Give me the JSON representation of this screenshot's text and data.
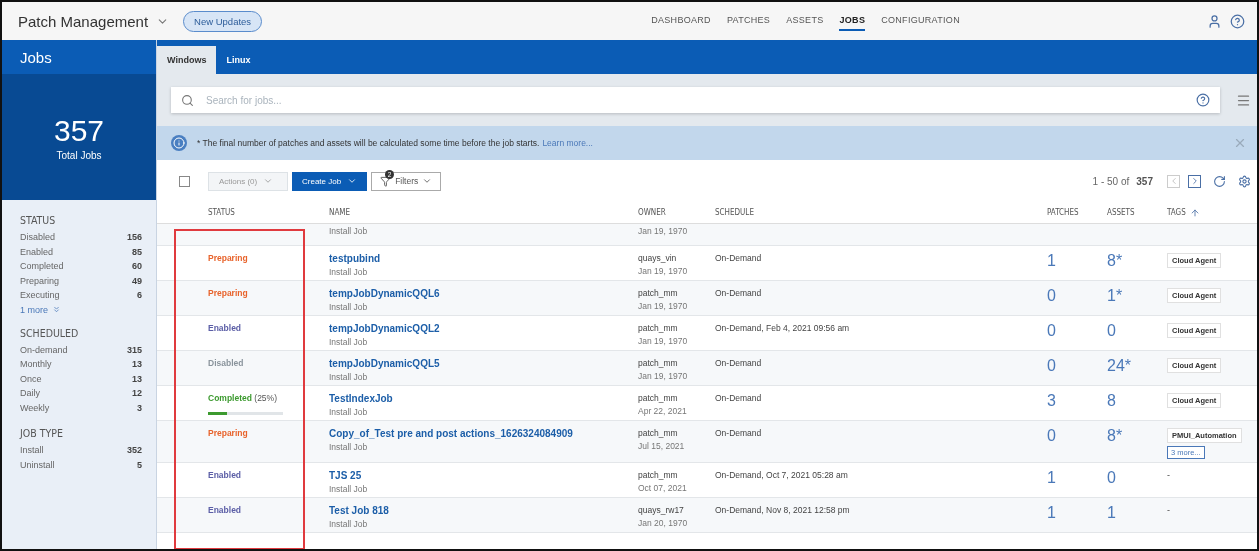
{
  "app": {
    "title": "Patch Management",
    "badge": "New Updates"
  },
  "nav": [
    {
      "label": "DASHBOARD",
      "selected": false
    },
    {
      "label": "PATCHES",
      "selected": false
    },
    {
      "label": "ASSETS",
      "selected": false
    },
    {
      "label": "JOBS",
      "selected": true
    },
    {
      "label": "CONFIGURATION",
      "selected": false
    }
  ],
  "sidebar": {
    "title": "Jobs",
    "total": "357",
    "total_label": "Total Jobs",
    "groups": [
      {
        "title": "STATUS",
        "items": [
          {
            "label": "Disabled",
            "count": "156"
          },
          {
            "label": "Enabled",
            "count": "85"
          },
          {
            "label": "Completed",
            "count": "60"
          },
          {
            "label": "Preparing",
            "count": "49"
          },
          {
            "label": "Executing",
            "count": "6"
          }
        ],
        "more": "1 more"
      },
      {
        "title": "SCHEDULED",
        "items": [
          {
            "label": "On-demand",
            "count": "315"
          },
          {
            "label": "Monthly",
            "count": "13"
          },
          {
            "label": "Once",
            "count": "13"
          },
          {
            "label": "Daily",
            "count": "12"
          },
          {
            "label": "Weekly",
            "count": "3"
          }
        ]
      },
      {
        "title": "JOB TYPE",
        "items": [
          {
            "label": "Install",
            "count": "352"
          },
          {
            "label": "Uninstall",
            "count": "5"
          }
        ]
      }
    ]
  },
  "tabs": [
    {
      "label": "Windows",
      "selected": true
    },
    {
      "label": "Linux",
      "selected": false
    }
  ],
  "search": {
    "placeholder": "Search for jobs..."
  },
  "banner": {
    "text": "* The final number of patches and assets will be calculated some time before the job starts.",
    "link": "Learn more..."
  },
  "toolbar": {
    "select_all": {
      "checked": false
    },
    "actions": "Actions (0)",
    "create": "Create Job",
    "filters": "Filters",
    "filter_count": "2",
    "range": "1 - 50 of",
    "total": "357"
  },
  "table": {
    "columns": [
      "STATUS",
      "NAME",
      "OWNER",
      "SCHEDULE",
      "PATCHES",
      "ASSETS",
      "TAGS"
    ],
    "rows": [
      {
        "kind": "partial",
        "type": "Install Job",
        "date": "Jan 19, 1970"
      },
      {
        "kind": "full",
        "status": "Preparing",
        "color": "#e8632b",
        "name": "testpubind",
        "type": "Install Job",
        "owner": "quays_vin",
        "date": "Jan 19, 1970",
        "schedule": "On-Demand",
        "patches": "1",
        "assets": "8*",
        "tags": [
          {
            "kind": "tag",
            "label": "Cloud Agent"
          }
        ]
      },
      {
        "kind": "full",
        "status": "Preparing",
        "color": "#e8632b",
        "name": "tempJobDynamicQQL6",
        "type": "Install Job",
        "owner": "patch_mm",
        "date": "Jan 19, 1970",
        "schedule": "On-Demand",
        "patches": "0",
        "assets": "1*",
        "tags": [
          {
            "kind": "tag",
            "label": "Cloud Agent"
          }
        ]
      },
      {
        "kind": "full",
        "status": "Enabled",
        "color": "#5b5ea6",
        "name": "tempJobDynamicQQL2",
        "type": "Install Job",
        "owner": "patch_mm",
        "date": "Jan 19, 1970",
        "schedule": "On-Demand, Feb 4, 2021 09:56 am",
        "patches": "0",
        "assets": "0",
        "tags": [
          {
            "kind": "tag",
            "label": "Cloud Agent"
          }
        ]
      },
      {
        "kind": "full",
        "status": "Disabled",
        "color": "#8a949c",
        "name": "tempJobDynamicQQL5",
        "type": "Install Job",
        "owner": "patch_mm",
        "date": "Jan 19, 1970",
        "schedule": "On-Demand",
        "patches": "0",
        "assets": "24*",
        "tags": [
          {
            "kind": "tag",
            "label": "Cloud Agent"
          }
        ]
      },
      {
        "kind": "full",
        "status": "Completed",
        "color": "#3c9a2f",
        "reading": "(25%)",
        "level": 0.25,
        "name": "TestIndexJob",
        "type": "Install Job",
        "owner": "patch_mm",
        "date": "Apr 22, 2021",
        "schedule": "On-Demand",
        "patches": "3",
        "assets": "8",
        "tags": [
          {
            "kind": "tag",
            "label": "Cloud Agent"
          }
        ]
      },
      {
        "kind": "full",
        "status": "Preparing",
        "color": "#e8632b",
        "name": "Copy_of_Test pre and post actions_1626324084909",
        "type": "Install Job",
        "owner": "patch_mm",
        "date": "Jul 15, 2021",
        "schedule": "On-Demand",
        "patches": "0",
        "assets": "8*",
        "tags": [
          {
            "kind": "tag",
            "label": "PMUI_Automation"
          },
          {
            "kind": "more",
            "label": "3 more..."
          }
        ]
      },
      {
        "kind": "full",
        "status": "Enabled",
        "color": "#5b5ea6",
        "name": "TJS 25",
        "type": "Install Job",
        "owner": "patch_mm",
        "date": "Oct 07, 2021",
        "schedule": "On-Demand, Oct 7, 2021 05:28 am",
        "patches": "1",
        "assets": "0",
        "tags": [
          {
            "kind": "none",
            "label": "-"
          }
        ]
      },
      {
        "kind": "full",
        "status": "Enabled",
        "color": "#5b5ea6",
        "name": "Test Job 818",
        "type": "Install Job",
        "owner": "quays_rw17",
        "date": "Jan 20, 1970",
        "schedule": "On-Demand, Nov 8, 2021 12:58 pm",
        "patches": "1",
        "assets": "1",
        "tags": [
          {
            "kind": "none",
            "label": "-"
          }
        ]
      }
    ]
  }
}
